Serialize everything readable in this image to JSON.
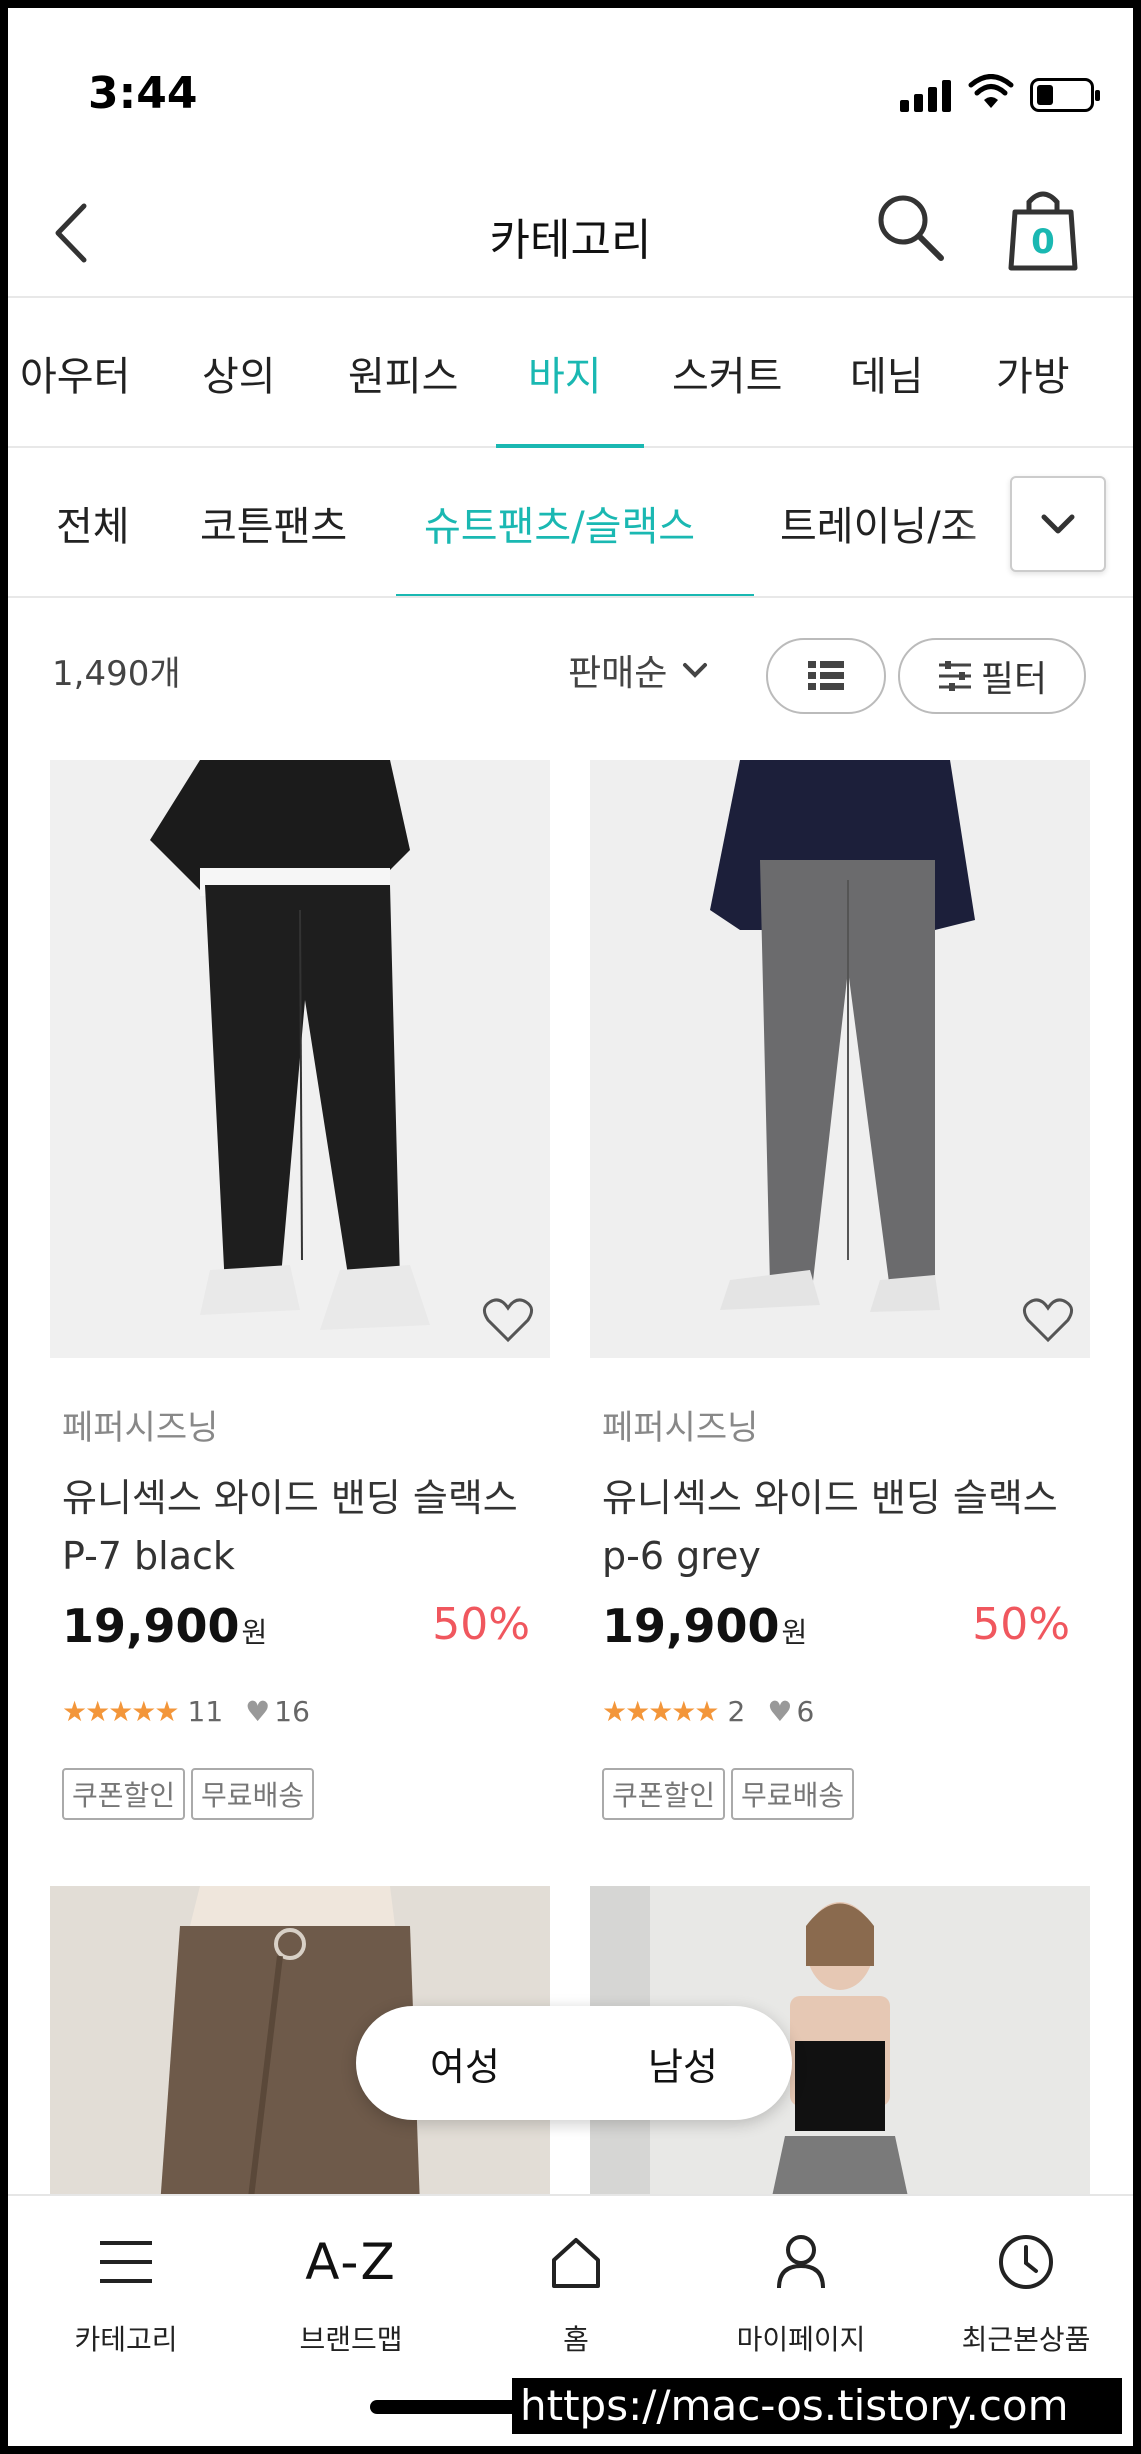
{
  "status": {
    "time": "3:44"
  },
  "nav": {
    "title": "카테고리",
    "cart_count": "0"
  },
  "category_tabs": [
    "아우터",
    "상의",
    "원피스",
    "바지",
    "스커트",
    "데님",
    "가방"
  ],
  "sub_tabs": [
    "전체",
    "코튼팬츠",
    "슈트팬츠/슬랙스",
    "트레이닝/조"
  ],
  "toolbar": {
    "count": "1,490개",
    "sort": "판매순",
    "filter": "필터"
  },
  "products": [
    {
      "brand": "페퍼시즈닝",
      "name": "유니섹스 와이드 밴딩 슬랙스 P-7 black",
      "price": "19,900",
      "currency": "원",
      "discount": "50%",
      "reviews": "11",
      "likes": "16",
      "tags": [
        "쿠폰할인",
        "무료배송"
      ]
    },
    {
      "brand": "페퍼시즈닝",
      "name": "유니섹스 와이드 밴딩 슬랙스 p-6 grey",
      "price": "19,900",
      "currency": "원",
      "discount": "50%",
      "reviews": "2",
      "likes": "6",
      "tags": [
        "쿠폰할인",
        "무료배송"
      ]
    }
  ],
  "gender": {
    "female": "여성",
    "male": "남성"
  },
  "tabbar": [
    {
      "label": "카테고리",
      "icon": "menu-icon"
    },
    {
      "label": "브랜드맵",
      "icon": "A-Z"
    },
    {
      "label": "홈",
      "icon": "home-icon"
    },
    {
      "label": "마이페이지",
      "icon": "person-icon"
    },
    {
      "label": "최근본상품",
      "icon": "clock-icon"
    }
  ],
  "watermark": "https://mac-os.tistory.com",
  "colors": {
    "accent": "#1ab8b2",
    "discount": "#f0575e",
    "star": "#f3963a"
  }
}
